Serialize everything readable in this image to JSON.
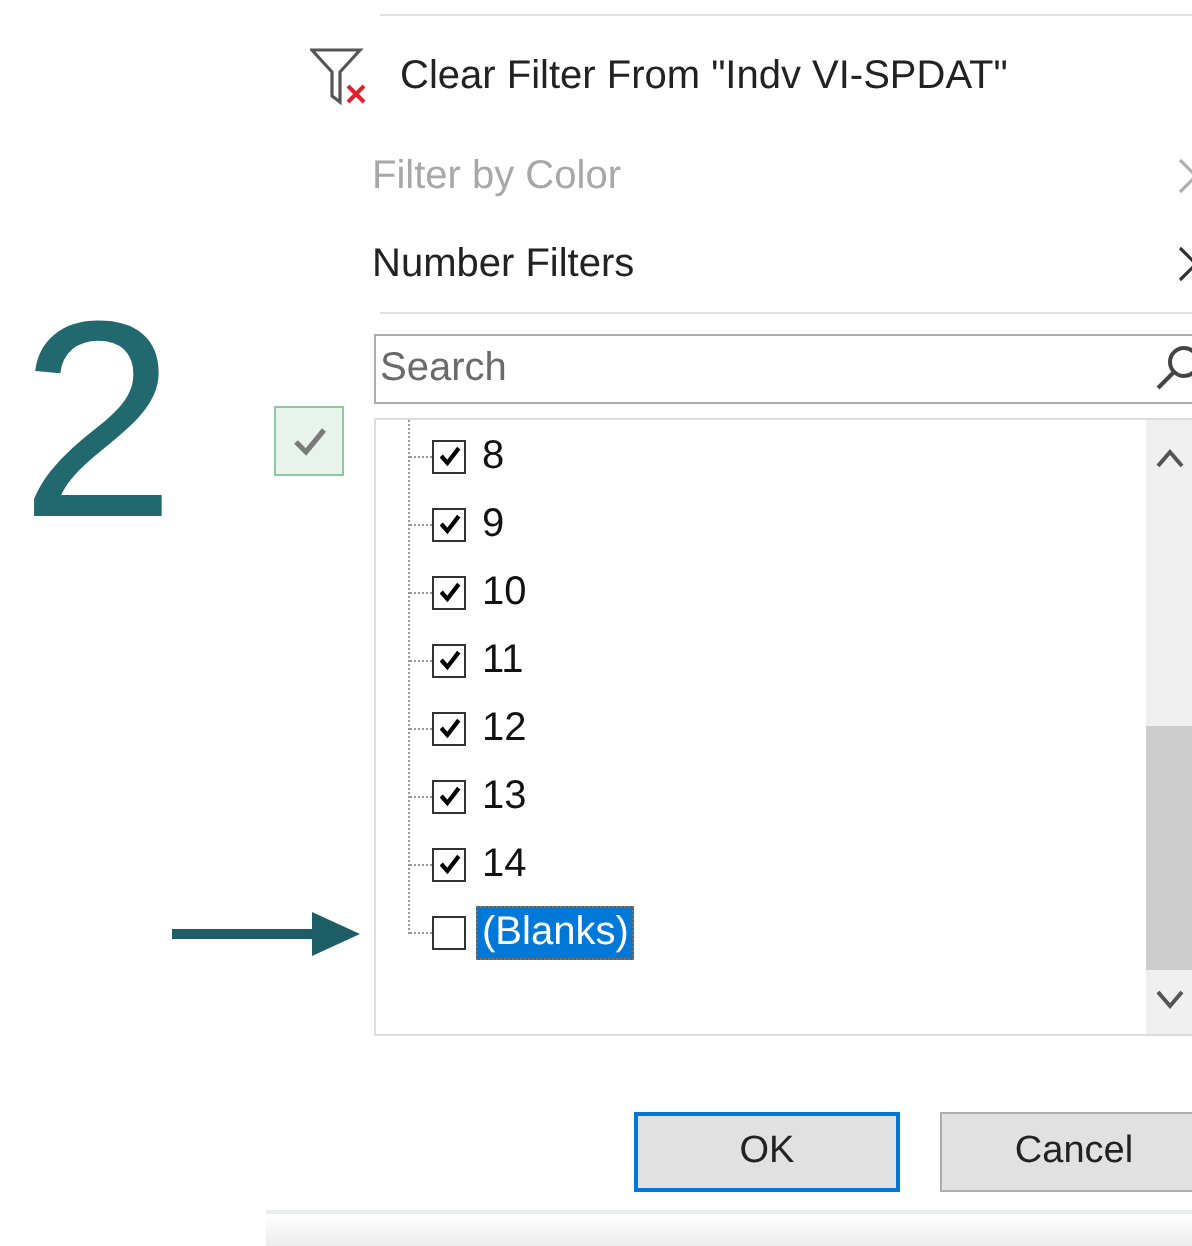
{
  "annotation": {
    "step": "2"
  },
  "menu": {
    "items": [
      {
        "kind": "action",
        "label": "Clear Filter From \"Indv VI-SPDAT\"",
        "disabled": false
      },
      {
        "kind": "submenu",
        "label": "Filter by Color",
        "disabled": true
      },
      {
        "kind": "submenu",
        "label": "Number Filters",
        "disabled": false
      }
    ]
  },
  "search": {
    "placeholder": "Search"
  },
  "values": [
    {
      "label": "8",
      "checked": true,
      "selected": false
    },
    {
      "label": "9",
      "checked": true,
      "selected": false
    },
    {
      "label": "10",
      "checked": true,
      "selected": false
    },
    {
      "label": "11",
      "checked": true,
      "selected": false
    },
    {
      "label": "12",
      "checked": true,
      "selected": false
    },
    {
      "label": "13",
      "checked": true,
      "selected": false
    },
    {
      "label": "14",
      "checked": true,
      "selected": false
    },
    {
      "label": "(Blanks)",
      "checked": false,
      "selected": true
    }
  ],
  "buttons": [
    {
      "label": "OK",
      "default": true
    },
    {
      "label": "Cancel",
      "default": false
    }
  ]
}
